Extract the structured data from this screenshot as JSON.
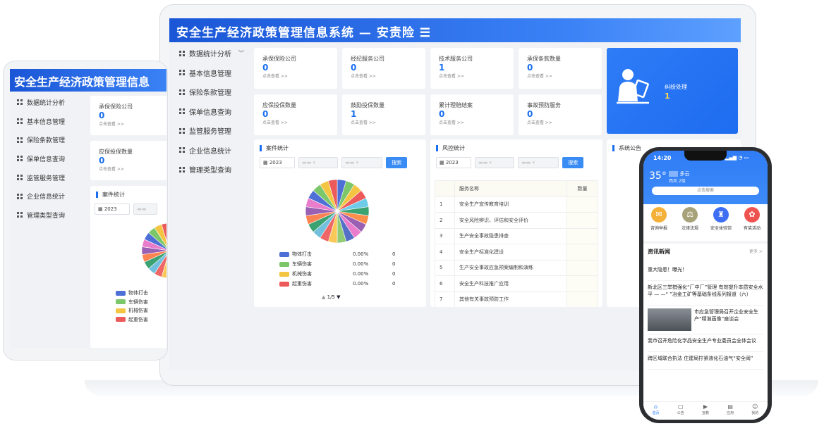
{
  "laptop": {
    "title": "安全生产经济政策管理信息系统 — 安责险 ☰",
    "menu": [
      {
        "label": "数据统计分析",
        "has_chevron": true
      },
      {
        "label": "基本信息管理"
      },
      {
        "label": "保险条款管理"
      },
      {
        "label": "保单信息查询"
      },
      {
        "label": "监管服务管理"
      },
      {
        "label": "企业信息统计"
      },
      {
        "label": "管理类型查询"
      }
    ],
    "stats": [
      {
        "title": "承保保险公司",
        "value": "0",
        "link": "点击查看 >>"
      },
      {
        "title": "经纪服务公司",
        "value": "0",
        "link": "点击查看 >>"
      },
      {
        "title": "技术服务公司",
        "value": "1",
        "link": "点击查看 >>"
      },
      {
        "title": "承保条款数量",
        "value": "0",
        "link": "点击查看 >>"
      },
      {
        "title": "应保投保数量",
        "value": "0",
        "link": "点击查看 >>"
      },
      {
        "title": "鼓励投保数量",
        "value": "1",
        "link": "点击查看 >>"
      },
      {
        "title": "累计理赔结案",
        "value": "0",
        "link": "点击查看 >>"
      },
      {
        "title": "事故预防服务",
        "value": "0",
        "link": "点击查看 >>"
      }
    ],
    "dispute": {
      "title": "纠纷处理",
      "value": "1"
    },
    "case_panel": {
      "title": "案件统计",
      "year": "2023",
      "search": "搜索",
      "legend": [
        {
          "name": "物体打击",
          "pct": "0.00%",
          "count": "0",
          "color": "#4e6fd6"
        },
        {
          "name": "车辆伤害",
          "pct": "0.00%",
          "count": "0",
          "color": "#7dc76b"
        },
        {
          "name": "机械伤害",
          "pct": "0.00%",
          "count": "0",
          "color": "#f4c542"
        },
        {
          "name": "起重伤害",
          "pct": "0.00%",
          "count": "0",
          "color": "#ec5a5a"
        }
      ],
      "pager": "1/5",
      "pie_colors": [
        "#4e6fd6",
        "#7dc76b",
        "#f4c542",
        "#ec5a5a",
        "#6fcbe8",
        "#3ba272",
        "#fb8e4a",
        "#9a60b4",
        "#ea7ccc",
        "#5470c6",
        "#91cc75",
        "#fac858",
        "#ee6666",
        "#73c0de",
        "#3ba272",
        "#fc8452",
        "#9a60b4",
        "#ea7ccc",
        "#4e6fd6",
        "#7dc76b",
        "#f4c542",
        "#ec5a5a"
      ]
    },
    "risk_panel": {
      "title": "风控统计",
      "year": "2023",
      "search": "搜索",
      "col_name": "服务名称",
      "col_count": "数量",
      "rows": [
        {
          "no": "1",
          "name": "安全生产宣传教育培训"
        },
        {
          "no": "2",
          "name": "安全风险辨识、评估和安全评价"
        },
        {
          "no": "3",
          "name": "生产安全事故隐患排查"
        },
        {
          "no": "4",
          "name": "安全生产标准化建设"
        },
        {
          "no": "5",
          "name": "生产安全事故应急预案编制和演练"
        },
        {
          "no": "6",
          "name": "安全生产科技推广应用"
        },
        {
          "no": "7",
          "name": "其他有关事故预防工作"
        }
      ]
    },
    "notice": {
      "title": "系统公告"
    }
  },
  "tablet": {
    "title": "安全生产经济政策管理信息",
    "menu": [
      "数据统计分析",
      "基本信息管理",
      "保险条款管理",
      "保单信息查询",
      "监管服务管理",
      "企业信息统计",
      "管理类型查询"
    ],
    "stats": [
      {
        "title": "承保保险公司",
        "value": "0",
        "link": "点击查看 >>"
      },
      {
        "title": "应保投保数量",
        "value": "0",
        "link": "点击查看 >>"
      }
    ],
    "case_title": "案件统计",
    "year": "2023",
    "legend": [
      {
        "name": "物体打击",
        "color": "#4e6fd6"
      },
      {
        "name": "车辆伤害",
        "color": "#7dc76b"
      },
      {
        "name": "机械伤害",
        "color": "#f4c542"
      },
      {
        "name": "起重伤害",
        "color": "#ec5a5a"
      }
    ]
  },
  "phone": {
    "time": "14:20",
    "temp": "35°",
    "weather": "多云",
    "wind": "西风 2级",
    "search": "点击搜索",
    "quick": [
      {
        "label": "咨询举报",
        "color": "#f4b13a"
      },
      {
        "label": "法律法规",
        "color": "#a7a27a"
      },
      {
        "label": "安全体验馆",
        "color": "#3e6ff2"
      },
      {
        "label": "有奖活动",
        "color": "#ef5350"
      }
    ],
    "news_title": "资讯新闻",
    "more": "更多 >",
    "news": [
      {
        "title": "重大隐患！曝光！"
      },
      {
        "title": "新北区三举措强化“厂中厂”管理 有效提升本质安全水平 — —“            ”冶金工矿等基础条线系列报道（六）"
      },
      {
        "title": "市应急管理局召开企业安全生产“精准画像”座谈会"
      },
      {
        "title": "我市召开危险化学品安全生产专业委员会全体会议"
      },
      {
        "title": "跨区域联合执法          住建局拧紧液化石油气“安全阀”"
      }
    ],
    "tabs": [
      "首页",
      "公告",
      "宣教",
      "应用",
      "我的"
    ]
  }
}
